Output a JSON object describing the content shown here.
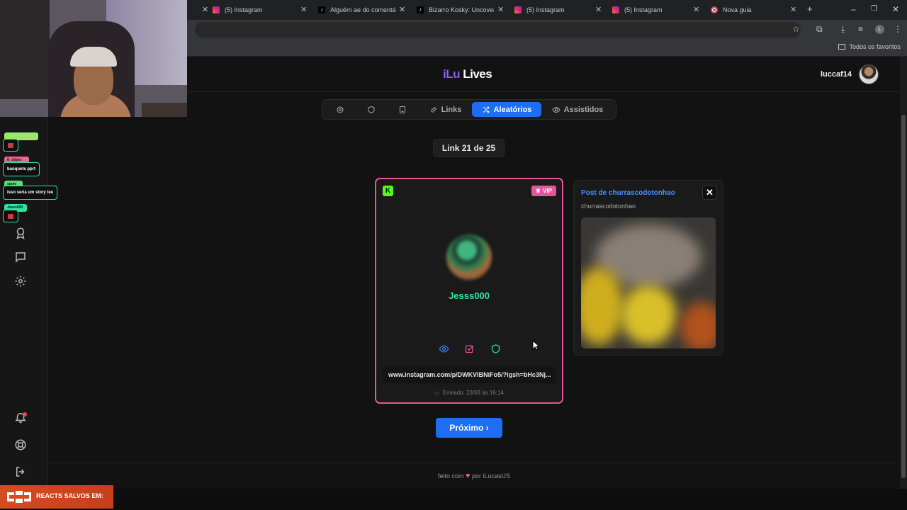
{
  "browser": {
    "tabs": [
      {
        "title": "(5) Instagram",
        "icon": "instagram-icon"
      },
      {
        "title": "Alguém ae do comentário",
        "icon": "tiktok-icon"
      },
      {
        "title": "Bizarro Kosky: Uncovering",
        "icon": "tiktok-icon"
      },
      {
        "title": "(5) Instagram",
        "icon": "instagram-icon"
      },
      {
        "title": "(5) Instagram",
        "icon": "instagram-icon"
      },
      {
        "title": "Nova guia",
        "icon": "chrome-icon"
      }
    ],
    "new_tab": "+",
    "profile_initial": "L",
    "bookmarks_folder": "Todos os favoritos"
  },
  "header": {
    "logo_part1": "iLu",
    "logo_part2": "Lives",
    "username": "luccaf14"
  },
  "nav": {
    "items": [
      {
        "label": "",
        "icon": "gear-icon"
      },
      {
        "label": "",
        "icon": "shield-icon"
      },
      {
        "label": "",
        "icon": "tablet-icon"
      },
      {
        "label": "Links",
        "icon": "link-icon"
      },
      {
        "label": "Aleatórios",
        "icon": "shuffle-icon",
        "active": true
      },
      {
        "label": "Assistidos",
        "icon": "eye-icon"
      }
    ]
  },
  "counter": "Link 21 de 25",
  "card": {
    "platform_badge": "K",
    "vip_label": "VIP",
    "name": "Jesss000",
    "link": "www.instagram.com/p/DWKVIBNiFo5/?igsh=bHc3Nj...",
    "sent": "Enviado: 23/03 às 16:14"
  },
  "preview": {
    "title": "Post de churrascodotonhao",
    "user": "churrascodotonhao",
    "close": "✕"
  },
  "next_button": "Próximo ›",
  "footer": {
    "prefix": "feito com",
    "heart": "♥",
    "suffix": "por iLucasUS"
  },
  "overlay": {
    "chat": [
      {
        "user": "ft_clipes",
        "message": "banquete pprt"
      },
      {
        "user": "spolo",
        "message": "isso seria um story teu"
      },
      {
        "user": "Jesss000",
        "message": ""
      }
    ],
    "reacts_banner": "REACTS SALVOS EM:"
  },
  "colors": {
    "accent": "#1d6ef3",
    "vip": "#e6559b",
    "name": "#2ee59d",
    "kick": "#53fc18"
  }
}
